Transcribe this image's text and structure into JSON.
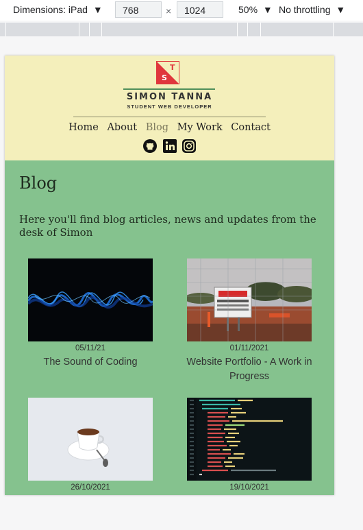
{
  "devtools": {
    "dimensions_label": "Dimensions: iPad",
    "width_value": "768",
    "times": "×",
    "height_value": "1024",
    "zoom_label": "50%",
    "throttle_label": "No throttling",
    "dropdown_arrow": "▼"
  },
  "site": {
    "logo_letters": [
      "S",
      "T"
    ],
    "brand_name": "SIMON TANNA",
    "brand_tagline": "STUDENT WEB DEVELOPER",
    "nav": [
      "Home",
      "About",
      "Blog",
      "My Work",
      "Contact"
    ],
    "active_nav": "Blog",
    "social_icons": [
      "github-icon",
      "linkedin-icon",
      "instagram-icon"
    ]
  },
  "main": {
    "title": "Blog",
    "intro": "Here you'll find blog articles, news and updates from the desk of Simon",
    "posts": [
      {
        "date": "05/11/21",
        "title": "The Sound of Coding",
        "image": "sound-wave-image"
      },
      {
        "date": "01/11/2021",
        "title": "Website Portfolio - A Work in Progress",
        "image": "construction-site-image"
      },
      {
        "date": "26/10/2021",
        "title": "",
        "image": "coffee-cup-image"
      },
      {
        "date": "19/10/2021",
        "title": "",
        "image": "code-editor-image"
      }
    ]
  },
  "colors": {
    "header_bg": "#f4efbb",
    "body_bg": "#85c28e",
    "accent_red": "#e0363c",
    "accent_green": "#4f8f5a"
  }
}
